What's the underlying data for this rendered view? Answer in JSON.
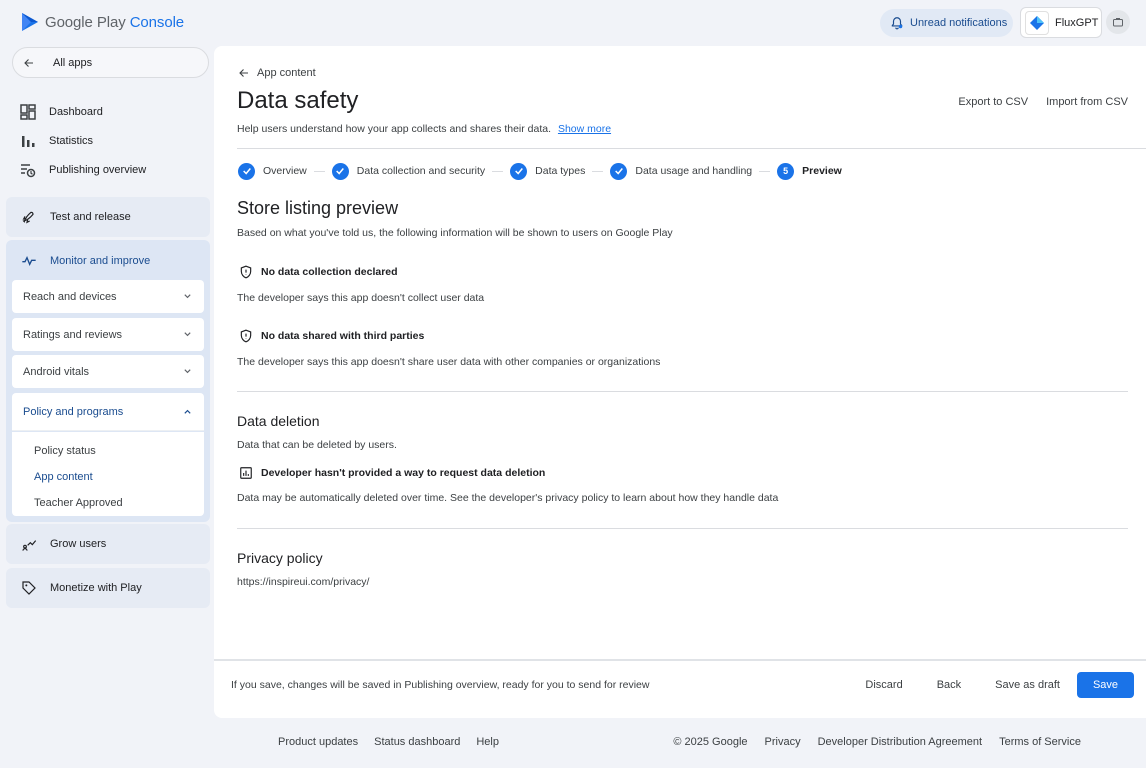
{
  "header": {
    "logo_text_main": "Google Play",
    "logo_text_accent": "Console",
    "notifications_label": "Unread notifications",
    "app_name": "FluxGPT"
  },
  "sidebar": {
    "all_apps": "All apps",
    "top_items": [
      {
        "label": "Dashboard",
        "icon": "dashboard-icon"
      },
      {
        "label": "Statistics",
        "icon": "bar-chart-icon"
      },
      {
        "label": "Publishing overview",
        "icon": "publishing-icon"
      }
    ],
    "sections": {
      "test_release": "Test and release",
      "monitor_improve": "Monitor and improve",
      "grow_users": "Grow users",
      "monetize": "Monetize with Play"
    },
    "monitor_sub": {
      "reach": "Reach and devices",
      "ratings": "Ratings and reviews",
      "vitals": "Android vitals",
      "policy": "Policy and programs"
    },
    "policy_items": [
      "Policy status",
      "App content",
      "Teacher Approved"
    ]
  },
  "main": {
    "back_label": "App content",
    "title": "Data safety",
    "export_csv": "Export to CSV",
    "import_csv": "Import from CSV",
    "intro": "Help users understand how your app collects and shares their data.",
    "show_more": "Show more",
    "steps": [
      {
        "label": "Overview",
        "state": "done"
      },
      {
        "label": "Data collection and security",
        "state": "done"
      },
      {
        "label": "Data types",
        "state": "done"
      },
      {
        "label": "Data usage and handling",
        "state": "done"
      },
      {
        "label": "Preview",
        "state": "current",
        "number": "5"
      }
    ],
    "preview_title": "Store listing preview",
    "preview_desc": "Based on what you've told us, the following information will be shown to users on Google Play",
    "no_collection_head": "No data collection declared",
    "no_collection_desc": "The developer says this app doesn't collect user data",
    "no_sharing_head": "No data shared with third parties",
    "no_sharing_desc": "The developer says this app doesn't share user data with other companies or organizations",
    "deletion_title": "Data deletion",
    "deletion_desc": "Data that can be deleted by users.",
    "deletion_head": "Developer hasn't provided a way to request data deletion",
    "deletion_detail": "Data may be automatically deleted over time. See the developer's privacy policy to learn about how they handle data",
    "privacy_title": "Privacy policy",
    "privacy_url": "https://inspireui.com/privacy/"
  },
  "bottom_bar": {
    "message": "If you save, changes will be saved in Publishing overview, ready for you to send for review",
    "discard": "Discard",
    "back": "Back",
    "save_draft": "Save as draft",
    "save": "Save"
  },
  "footer": {
    "left": [
      "Product updates",
      "Status dashboard",
      "Help"
    ],
    "right": [
      "© 2025 Google",
      "Privacy",
      "Developer Distribution Agreement",
      "Terms of Service"
    ]
  },
  "colors": {
    "accent": "#1a73e8",
    "active_text": "#1a4c8f",
    "nav_bg": "#e6ebf4"
  }
}
